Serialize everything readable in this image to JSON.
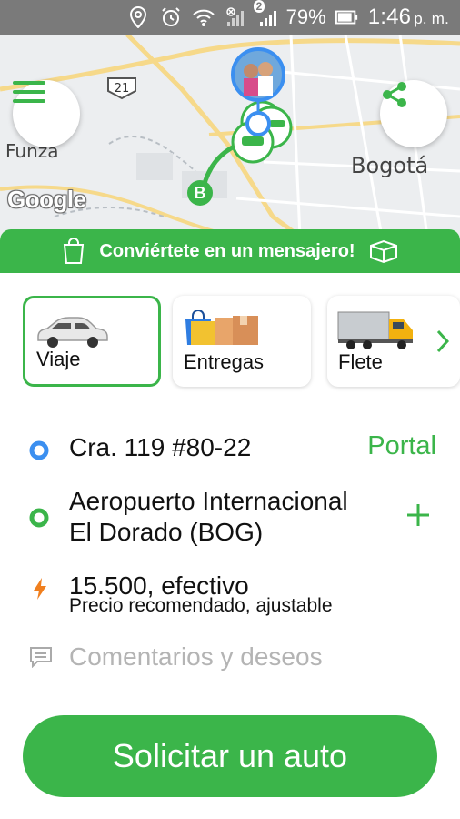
{
  "status_bar": {
    "notification_count": "2",
    "battery_percent": "79%",
    "time": "1:46",
    "time_suffix": "p. m."
  },
  "map": {
    "place_funza": "Funza",
    "place_bogota": "Bogotá",
    "route_shield": "21",
    "destination_marker": "B",
    "attribution": "Google"
  },
  "banner": {
    "text": "Conviértete en un mensajero!"
  },
  "services": [
    {
      "label": "Viaje",
      "selected": true,
      "icon": "car-icon"
    },
    {
      "label": "Entregas",
      "selected": false,
      "icon": "bags-boxes-icon"
    },
    {
      "label": "Flete",
      "selected": false,
      "icon": "truck-icon"
    }
  ],
  "trip": {
    "origin": "Cra. 119 #80-22",
    "origin_action": "Portal",
    "destination_line1": "Aeropuerto Internacional",
    "destination_line2": "El Dorado (BOG)",
    "price": "15.500, efectivo",
    "price_hint": "Precio recomendado, ajustable",
    "comments_placeholder": "Comentarios y deseos"
  },
  "cta": {
    "label": "Solicitar un auto"
  },
  "colors": {
    "accent": "#3bb54a",
    "origin_dot": "#3b8ff0",
    "price_bolt": "#f07f1e"
  }
}
